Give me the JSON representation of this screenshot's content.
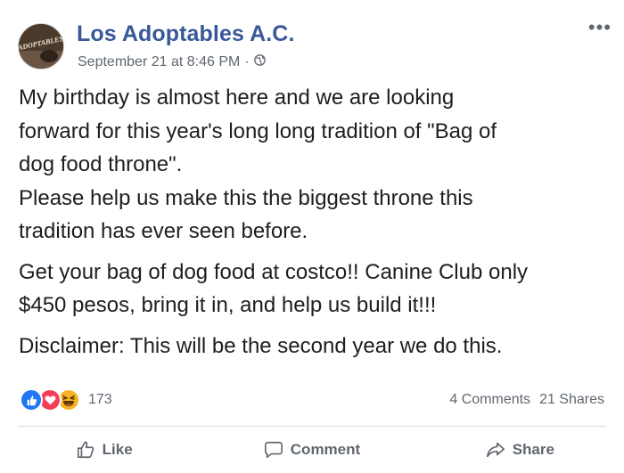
{
  "post": {
    "page_name": "Los Adoptables A.C.",
    "avatar_text": "ADOPTABLES",
    "timestamp": "September 21 at 8:46 PM",
    "separator": "·",
    "privacy_icon": "globe-icon",
    "more_label": "•••",
    "body": {
      "line1": "My birthday is almost here and we are looking",
      "line2": "forward for this year's long long tradition of \"Bag of",
      "line3": "dog food throne\".",
      "line4": "Please help us make this the biggest throne this",
      "line5": "tradition has ever seen before.",
      "para2_line1": "Get your bag of dog food at costco!! Canine Club only",
      "para2_line2": "$450 pesos, bring it in, and help us build it!!!",
      "para3": "Disclaimer: This will be the second year we do this."
    }
  },
  "reactions": {
    "icons": [
      "like-icon",
      "love-icon",
      "haha-icon"
    ],
    "count": "173",
    "colors": {
      "like": "#2078f4",
      "love": "#f33e58",
      "haha": "#f7b125"
    }
  },
  "stats": {
    "comments": "4 Comments",
    "shares": "21 Shares"
  },
  "actions": {
    "like": "Like",
    "comment": "Comment",
    "share": "Share"
  },
  "colors": {
    "brand": "#385898",
    "text": "#1c1e21",
    "muted": "#606770",
    "divider": "#dadde1"
  }
}
